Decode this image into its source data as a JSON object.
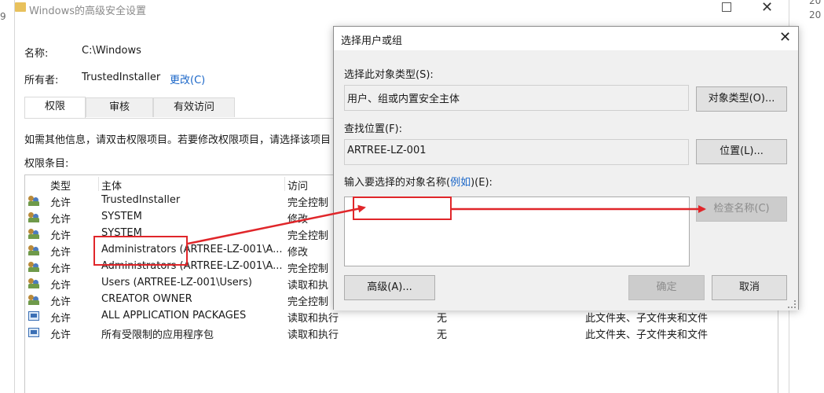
{
  "window": {
    "title": "Windows的高级安全设置",
    "name_label": "名称:",
    "name_value": "C:\\Windows",
    "owner_label": "所有者:",
    "owner_value": "TrustedInstaller",
    "owner_change_link": "更改(C)",
    "tabs": [
      "权限",
      "审核",
      "有效访问"
    ],
    "info_text": "如需其他信息，请双击权限项目。若要修改权限项目，请选择该项目",
    "entries_label": "权限条目:",
    "columns": [
      "类型",
      "主体",
      "访问"
    ],
    "rows": [
      {
        "icon": "users-icon",
        "type": "允许",
        "principal": "TrustedInstaller",
        "access": "完全控制",
        "inherited": "",
        "applies": ""
      },
      {
        "icon": "users-icon",
        "type": "允许",
        "principal": "SYSTEM",
        "access": "修改",
        "inherited": "",
        "applies": ""
      },
      {
        "icon": "users-icon",
        "type": "允许",
        "principal": "SYSTEM",
        "access": "完全控制",
        "inherited": "",
        "applies": ""
      },
      {
        "icon": "users-icon",
        "type": "允许",
        "principal": "Administrators (ARTREE-LZ-001\\A...",
        "access": "修改",
        "inherited": "",
        "applies": ""
      },
      {
        "icon": "users-icon",
        "type": "允许",
        "principal": "Administrators (ARTREE-LZ-001\\A...",
        "access": "完全控制",
        "inherited": "",
        "applies": ""
      },
      {
        "icon": "users-icon",
        "type": "允许",
        "principal": "Users (ARTREE-LZ-001\\Users)",
        "access": "读取和执",
        "inherited": "",
        "applies": ""
      },
      {
        "icon": "users-icon",
        "type": "允许",
        "principal": "CREATOR OWNER",
        "access": "完全控制",
        "inherited": "",
        "applies": ""
      },
      {
        "icon": "package-icon",
        "type": "允许",
        "principal": "ALL APPLICATION PACKAGES",
        "access": "读取和执行",
        "inherited": "无",
        "applies": "此文件夹、子文件夹和文件"
      },
      {
        "icon": "package-icon",
        "type": "允许",
        "principal": "所有受限制的应用程序包",
        "access": "读取和执行",
        "inherited": "无",
        "applies": "此文件夹、子文件夹和文件"
      }
    ]
  },
  "edge_numbers": {
    "left": "9",
    "right_top": "20",
    "right_second": "20"
  },
  "dialog": {
    "title": "选择用户或组",
    "object_type_label": "选择此对象类型(S):",
    "object_type_value": "用户、组或内置安全主体",
    "object_types_button": "对象类型(O)...",
    "location_label": "查找位置(F):",
    "location_value": "ARTREE-LZ-001",
    "locations_button": "位置(L)...",
    "names_label_prefix": "输入要选择的对象名称(",
    "names_label_link": "例如",
    "names_label_suffix": ")(E):",
    "names_value": "",
    "check_names_button": "检查名称(C)",
    "advanced_button": "高级(A)...",
    "ok_button": "确定",
    "cancel_button": "取消"
  },
  "colors": {
    "annotation": "#e0262a",
    "link": "#1a66c8"
  }
}
